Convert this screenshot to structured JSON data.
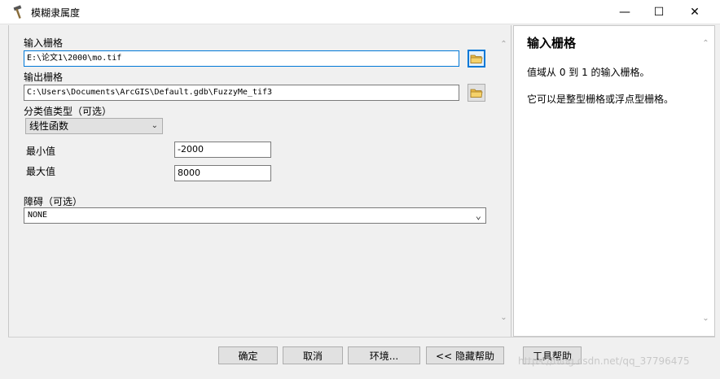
{
  "window": {
    "title": "模糊隶属度",
    "minimize": "—",
    "maximize": "☐",
    "close": "✕"
  },
  "form": {
    "input_raster_label": "输入栅格",
    "input_raster_value": "E:\\论文1\\2000\\mo.tif",
    "output_raster_label": "输出栅格",
    "output_raster_value": "C:\\Users\\Documents\\ArcGIS\\Default.gdb\\FuzzyMe_tif3",
    "membership_type_label": "分类值类型（可选）",
    "membership_type_value": "线性函数",
    "min_label": "最小值",
    "min_value": "-2000",
    "max_label": "最大值",
    "max_value": "8000",
    "barrier_label": "障碍（可选）",
    "barrier_value": "NONE"
  },
  "help": {
    "title": "输入栅格",
    "line1": "值域从 0 到 1 的输入栅格。",
    "line2": "它可以是整型栅格或浮点型栅格。"
  },
  "buttons": {
    "ok": "确定",
    "cancel": "取消",
    "environments": "环境...",
    "hide_help": "<< 隐藏帮助",
    "tool_help": "工具帮助"
  },
  "watermark": "https://blog.csdn.net/qq_37796475",
  "icons": {
    "title": "hammer-icon",
    "browse": "folder-icon"
  }
}
